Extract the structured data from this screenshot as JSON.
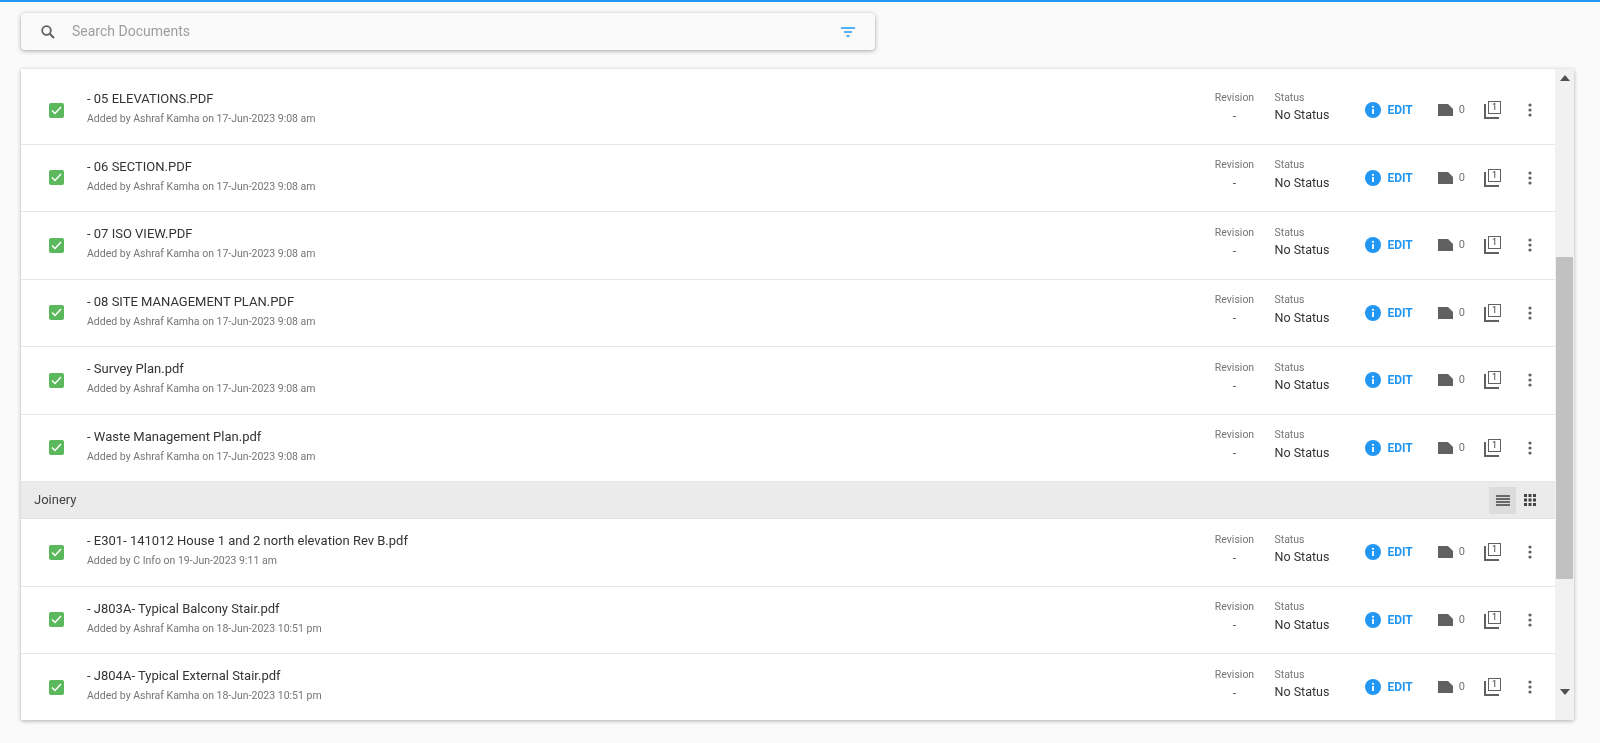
{
  "search": {
    "placeholder": "Search Documents"
  },
  "sections": [
    {
      "rows": [
        {
          "checked": true,
          "name": "- 05 ELEVATIONS.PDF",
          "added": "Added by Ashraf Kamha on 17-Jun-2023 9:08 am",
          "revision_label": "Revision",
          "revision": "-",
          "status_label": "Status",
          "status": "No Status",
          "edit": "EDIT",
          "count": "0",
          "copies": "1"
        },
        {
          "checked": true,
          "name": "- 06 SECTION.PDF",
          "added": "Added by Ashraf Kamha on 17-Jun-2023 9:08 am",
          "revision_label": "Revision",
          "revision": "-",
          "status_label": "Status",
          "status": "No Status",
          "edit": "EDIT",
          "count": "0",
          "copies": "1"
        },
        {
          "checked": true,
          "name": "- 07 ISO VIEW.PDF",
          "added": "Added by Ashraf Kamha on 17-Jun-2023 9:08 am",
          "revision_label": "Revision",
          "revision": "-",
          "status_label": "Status",
          "status": "No Status",
          "edit": "EDIT",
          "count": "0",
          "copies": "1"
        },
        {
          "checked": true,
          "name": "- 08 SITE MANAGEMENT PLAN.PDF",
          "added": "Added by Ashraf Kamha on 17-Jun-2023 9:08 am",
          "revision_label": "Revision",
          "revision": "-",
          "status_label": "Status",
          "status": "No Status",
          "edit": "EDIT",
          "count": "0",
          "copies": "1"
        },
        {
          "checked": true,
          "name": "- Survey Plan.pdf",
          "added": "Added by Ashraf Kamha on 17-Jun-2023 9:08 am",
          "revision_label": "Revision",
          "revision": "-",
          "status_label": "Status",
          "status": "No Status",
          "edit": "EDIT",
          "count": "0",
          "copies": "1"
        },
        {
          "checked": true,
          "name": "- Waste Management Plan.pdf",
          "added": "Added by Ashraf Kamha on 17-Jun-2023 9:08 am",
          "revision_label": "Revision",
          "revision": "-",
          "status_label": "Status",
          "status": "No Status",
          "edit": "EDIT",
          "count": "0",
          "copies": "1"
        }
      ]
    },
    {
      "title": "Joinery",
      "view_modes": [
        {
          "kind": "list",
          "selected": true
        },
        {
          "kind": "grid",
          "selected": false
        }
      ],
      "rows": [
        {
          "checked": true,
          "name": "- E301- 141012 House 1 and 2 north elevation Rev B.pdf",
          "added": "Added by C Info on 19-Jun-2023 9:11 am",
          "revision_label": "Revision",
          "revision": "-",
          "status_label": "Status",
          "status": "No Status",
          "edit": "EDIT",
          "count": "0",
          "copies": "1"
        },
        {
          "checked": true,
          "name": "- J803A- Typical Balcony Stair.pdf",
          "added": "Added by Ashraf Kamha on 18-Jun-2023 10:51 pm",
          "revision_label": "Revision",
          "revision": "-",
          "status_label": "Status",
          "status": "No Status",
          "edit": "EDIT",
          "count": "0",
          "copies": "1"
        },
        {
          "checked": true,
          "name": "- J804A- Typical External Stair.pdf",
          "added": "Added by Ashraf Kamha on 18-Jun-2023 10:51 pm",
          "revision_label": "Revision",
          "revision": "-",
          "status_label": "Status",
          "status": "No Status",
          "edit": "EDIT",
          "count": "0",
          "copies": "1"
        }
      ]
    }
  ]
}
